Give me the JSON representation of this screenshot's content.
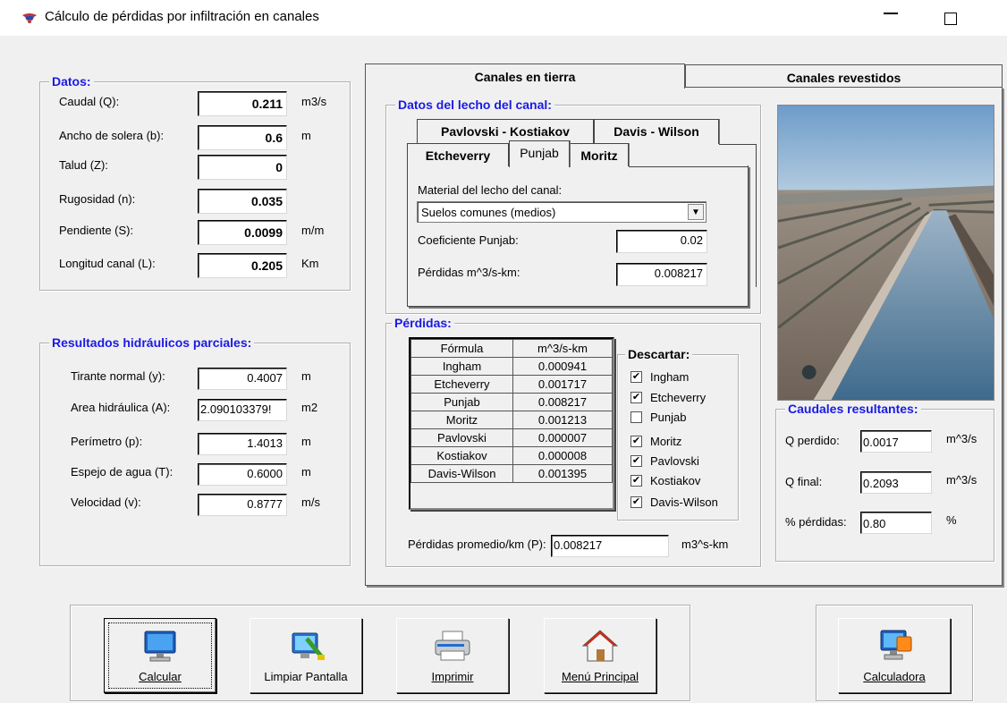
{
  "window": {
    "title": "Cálculo de pérdidas por infiltración en canales",
    "app_icon": "app-icon",
    "controls": [
      "minimize-icon",
      "maximize-icon"
    ]
  },
  "datos": {
    "legend": "Datos:",
    "rows": [
      {
        "label": "Caudal (Q):",
        "value": "0.211",
        "unit": "m3/s"
      },
      {
        "label": "Ancho de solera (b):",
        "value": "0.6",
        "unit": "m"
      },
      {
        "label": "Talud (Z):",
        "value": "0",
        "unit": ""
      },
      {
        "label": "Rugosidad (n):",
        "value": "0.035",
        "unit": ""
      },
      {
        "label": "Pendiente (S):",
        "value": "0.0099",
        "unit": "m/m"
      },
      {
        "label": "Longitud  canal (L):",
        "value": "0.205",
        "unit": "Km"
      }
    ]
  },
  "resultados": {
    "legend": "Resultados hidráulicos parciales:",
    "rows": [
      {
        "label": "Tirante normal (y):",
        "value": "0.4007",
        "unit": "m"
      },
      {
        "label": "Area hidráulica (A):",
        "value": "2.090103379!",
        "unit": "m2"
      },
      {
        "label": "Perímetro (p):",
        "value": "1.4013",
        "unit": "m"
      },
      {
        "label": "Espejo de agua (T):",
        "value": "0.6000",
        "unit": "m"
      },
      {
        "label": "Velocidad (v):",
        "value": "0.8777",
        "unit": "m/s"
      }
    ]
  },
  "tabs": {
    "active": "Canales en tierra",
    "items": [
      "Canales en tierra",
      "Canales revestidos"
    ]
  },
  "lecho": {
    "legend": "Datos del lecho del canal:",
    "subtabs_row1": [
      "Pavlovski - Kostiakov",
      "Davis - Wilson"
    ],
    "subtabs_row2": [
      "Etcheverry",
      "Punjab",
      "Moritz"
    ],
    "active_subtab": "Punjab",
    "material_label": "Material del lecho del canal:",
    "material_value": "Suelos comunes (medios)",
    "coef_label": "Coeficiente Punjab:",
    "coef_value": "0.02",
    "perdidas_label": "Pérdidas m^3/s-km:",
    "perdidas_value": "0.008217"
  },
  "perdidas": {
    "legend": "Pérdidas:",
    "table_headers": [
      "Fórmula",
      "m^3/s-km"
    ],
    "table_rows": [
      [
        "Ingham",
        "0.000941"
      ],
      [
        "Etcheverry",
        "0.001717"
      ],
      [
        "Punjab",
        "0.008217"
      ],
      [
        "Moritz",
        "0.001213"
      ],
      [
        "Pavlovski",
        "0.000007"
      ],
      [
        "Kostiakov",
        "0.000008"
      ],
      [
        "Davis-Wilson",
        "0.001395"
      ]
    ],
    "descartar_legend": "Descartar:",
    "descartar": [
      {
        "label": "Ingham",
        "checked": true
      },
      {
        "label": "Etcheverry",
        "checked": true
      },
      {
        "label": "Punjab",
        "checked": false
      },
      {
        "label": "Moritz",
        "checked": true
      },
      {
        "label": "Pavlovski",
        "checked": true
      },
      {
        "label": "Kostiakov",
        "checked": true
      },
      {
        "label": "Davis-Wilson",
        "checked": true
      }
    ],
    "promedio_label": "Pérdidas promedio/km (P):",
    "promedio_value": "0.008217",
    "promedio_unit": "m3^s-km"
  },
  "caudales": {
    "legend": "Caudales resultantes:",
    "rows": [
      {
        "label": "Q perdido:",
        "value": "0.0017",
        "unit": "m^3/s"
      },
      {
        "label": "Q final:",
        "value": "0.2093",
        "unit": "m^3/s"
      },
      {
        "label": "% pérdidas:",
        "value": "0.80",
        "unit": "%"
      }
    ]
  },
  "buttons": [
    {
      "label": "Calcular",
      "icon": "monitor-icon"
    },
    {
      "label": "Limpiar Pantalla",
      "icon": "clean-screen-icon"
    },
    {
      "label": "Imprimir",
      "icon": "printer-icon"
    },
    {
      "label": "Menú Principal",
      "icon": "home-icon"
    },
    {
      "label": "Calculadora",
      "icon": "calculator-icon"
    }
  ],
  "photo": "irrigation-canal-photo"
}
